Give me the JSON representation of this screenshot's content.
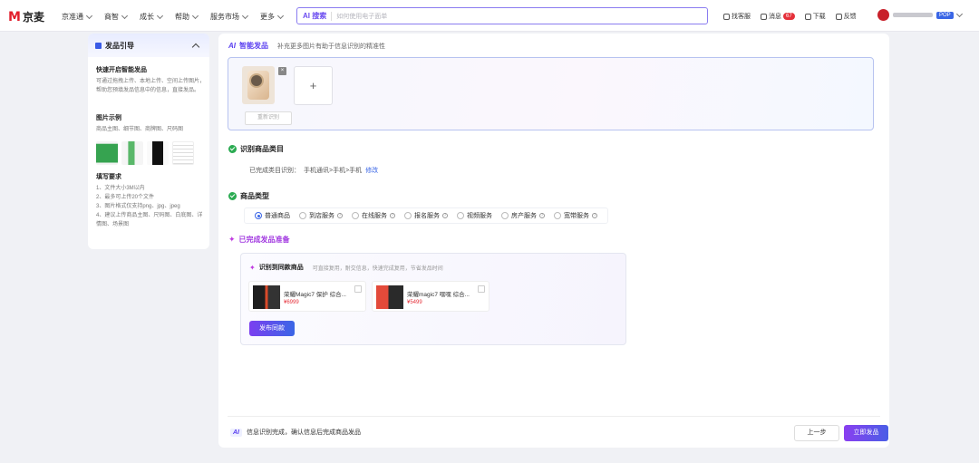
{
  "brand": {
    "mark": "M",
    "name": "京麦",
    "color": "#e21e2b"
  },
  "nav": [
    {
      "label": "京准通"
    },
    {
      "label": "商智"
    },
    {
      "label": "成长"
    },
    {
      "label": "帮助"
    },
    {
      "label": "服务市场"
    },
    {
      "label": "更多"
    }
  ],
  "search": {
    "ai_label": "AI 搜索",
    "placeholder": "如何使用电子面单"
  },
  "tools": [
    {
      "icon": "headset-icon",
      "label": "找客服"
    },
    {
      "icon": "bell-icon",
      "label": "消息",
      "badge": "67"
    },
    {
      "icon": "monitor-icon",
      "label": "下载"
    },
    {
      "icon": "edit-icon",
      "label": "反馈"
    }
  ],
  "user": {
    "tag": "POP"
  },
  "guide": {
    "title": "发品引导",
    "sections": [
      {
        "heading": "快速开启智能发品",
        "text": "可通过拖拽上传、本地上传、空间上传图片，帮助您预填发品信息中的信息，直接发品。"
      },
      {
        "heading": "图片示例",
        "text": "商品主图、细节图、商牌图、尺码图"
      },
      {
        "heading": "填写要求",
        "text": "1、文件大小3M以内\n2、最多可上传20个文件\n3、图片格式仅支持png、jpg、jpeg\n4、建议上传商品主图、尺码图、白底图、详情图、场景图"
      }
    ]
  },
  "main": {
    "header": {
      "ai": "AI",
      "title": "智能发品",
      "hint": "补充更多图片有助于信息识别的精准性"
    },
    "upload": {
      "delete": "×",
      "add": "+",
      "reidentify": "重新识别"
    },
    "category": {
      "title": "识别商品类目",
      "prefix": "已完成类目识别：",
      "path": "手机通讯>手机>手机",
      "modify": "修改"
    },
    "type": {
      "title": "商品类型",
      "options": [
        "普通商品",
        "到店服务",
        "在线服务",
        "报名服务",
        "视频服务",
        "房产服务",
        "宽带服务"
      ],
      "selected": 0
    },
    "ready": {
      "title": "已完成发品准备",
      "box_title": "识别到同款商品",
      "box_hint": "可直接复用，耐交信息，快速完成复用，节省发品时间",
      "products": [
        {
          "name": "荣耀Magic7 保护 综合...",
          "price": "¥6999"
        },
        {
          "name": "荣耀magic7 嘿嘿 综合...",
          "price": "¥5499"
        }
      ],
      "publish": "发布同款"
    },
    "footer": {
      "ai": "AI",
      "message": "信息识别完成，确认信息后完成商品发品",
      "prev": "上一步",
      "submit": "立即发品"
    }
  },
  "colors": {
    "accent": "#3a66e6",
    "ai_purple": "#5b40f0",
    "success": "#2bab52",
    "badge": "#e5303a"
  }
}
